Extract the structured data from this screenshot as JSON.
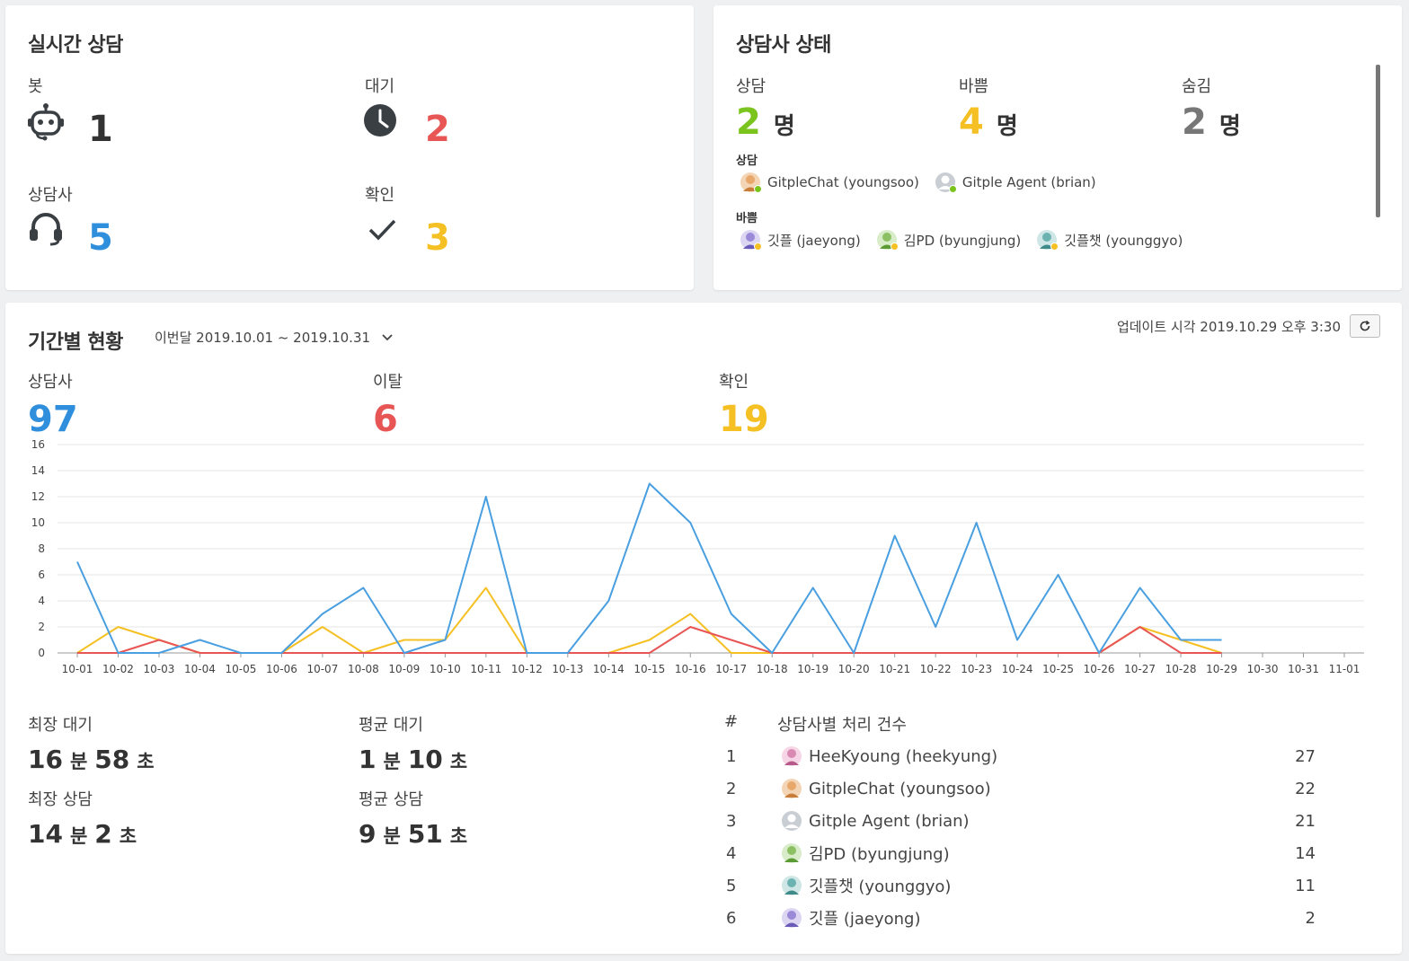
{
  "realtime": {
    "title": "실시간 상담",
    "bot": {
      "label": "봇",
      "value": "1",
      "color": "#333333"
    },
    "waiting": {
      "label": "대기",
      "value": "2",
      "color": "#e85555"
    },
    "agent": {
      "label": "상담사",
      "value": "5",
      "color": "#2f8fdc"
    },
    "confirm": {
      "label": "확인",
      "value": "3",
      "color": "#f5c023"
    }
  },
  "agent_status": {
    "title": "상담사 상태",
    "counsel": {
      "label": "상담",
      "value": "2",
      "unit": "명",
      "color": "#7ac41d"
    },
    "busy": {
      "label": "바쁨",
      "value": "4",
      "unit": "명",
      "color": "#f5c023"
    },
    "hidden": {
      "label": "숨김",
      "value": "2",
      "unit": "명",
      "color": "#777777"
    },
    "groups": [
      {
        "title": "상담",
        "agents": [
          {
            "name": "GitpleChat (youngsoo)",
            "avatar": "avatar-orange-icon",
            "status": "#7ac41d"
          },
          {
            "name": "Gitple Agent (brian)",
            "avatar": "avatar-default-icon",
            "status": "#7ac41d"
          }
        ]
      },
      {
        "title": "바쁨",
        "agents": [
          {
            "name": "깃플 (jaeyong)",
            "avatar": "avatar-purple-icon",
            "status": "#f5c023"
          },
          {
            "name": "김PD (byungjung)",
            "avatar": "avatar-green-icon",
            "status": "#f5c023"
          },
          {
            "name": "깃플챗 (younggyo)",
            "avatar": "avatar-teal-icon",
            "status": "#f5c023"
          }
        ]
      }
    ]
  },
  "period": {
    "title": "기간별 현황",
    "range_label": "이번달 2019.10.01 ~ 2019.10.31",
    "update_label": "업데이트 시각 2019.10.29 오후 3:30",
    "kpis": {
      "agent": {
        "label": "상담사",
        "value": "97",
        "color": "#2f8fdc"
      },
      "leave": {
        "label": "이탈",
        "value": "6",
        "color": "#e85555"
      },
      "confirm": {
        "label": "확인",
        "value": "19",
        "color": "#f5c023"
      }
    },
    "times": {
      "longest_wait": {
        "label": "최장 대기",
        "min": "16",
        "sec": "58",
        "min_unit": "분",
        "sec_unit": "초"
      },
      "avg_wait": {
        "label": "평균 대기",
        "min": "1",
        "sec": "10",
        "min_unit": "분",
        "sec_unit": "초"
      },
      "longest_counsel": {
        "label": "최장 상담",
        "min": "14",
        "sec": "2",
        "min_unit": "분",
        "sec_unit": "초"
      },
      "avg_counsel": {
        "label": "평균 상담",
        "min": "9",
        "sec": "51",
        "min_unit": "분",
        "sec_unit": "초"
      }
    },
    "ranking": {
      "index_header": "#",
      "title": "상담사별 처리 건수",
      "rows": [
        {
          "rank": "1",
          "name": "HeeKyoung (heekyung)",
          "avatar": "avatar-pink-icon",
          "count": "27"
        },
        {
          "rank": "2",
          "name": "GitpleChat (youngsoo)",
          "avatar": "avatar-orange-icon",
          "count": "22"
        },
        {
          "rank": "3",
          "name": "Gitple Agent (brian)",
          "avatar": "avatar-default-icon",
          "count": "21"
        },
        {
          "rank": "4",
          "name": "김PD (byungjung)",
          "avatar": "avatar-green-icon",
          "count": "14"
        },
        {
          "rank": "5",
          "name": "깃플챗 (younggyo)",
          "avatar": "avatar-teal-icon",
          "count": "11"
        },
        {
          "rank": "6",
          "name": "깃플 (jaeyong)",
          "avatar": "avatar-purple-icon",
          "count": "2"
        }
      ]
    }
  },
  "chart_data": {
    "type": "line",
    "categories": [
      "10-01",
      "10-02",
      "10-03",
      "10-04",
      "10-05",
      "10-06",
      "10-07",
      "10-08",
      "10-09",
      "10-10",
      "10-11",
      "10-12",
      "10-13",
      "10-14",
      "10-15",
      "10-16",
      "10-17",
      "10-18",
      "10-19",
      "10-20",
      "10-21",
      "10-22",
      "10-23",
      "10-24",
      "10-25",
      "10-26",
      "10-27",
      "10-28",
      "10-29",
      "10-30",
      "10-31",
      "11-01"
    ],
    "ylim": [
      0,
      16
    ],
    "yticks": [
      "0",
      "2",
      "4",
      "6",
      "8",
      "10",
      "12",
      "14",
      "16"
    ],
    "grid": true,
    "series": [
      {
        "color": "#f5c023",
        "values": [
          0,
          2,
          1,
          0,
          0,
          0,
          2,
          0,
          1,
          1,
          5,
          0,
          0,
          0,
          1,
          3,
          0,
          0,
          0,
          0,
          0,
          0,
          0,
          0,
          0,
          0,
          2,
          1,
          0,
          null,
          null,
          null
        ]
      },
      {
        "color": "#e85555",
        "values": [
          0,
          0,
          1,
          0,
          0,
          0,
          0,
          0,
          0,
          0,
          0,
          0,
          0,
          0,
          0,
          2,
          1,
          0,
          0,
          0,
          0,
          0,
          0,
          0,
          0,
          0,
          2,
          0,
          0,
          null,
          null,
          null
        ]
      },
      {
        "color": "#4a9fe0",
        "values": [
          7,
          0,
          0,
          1,
          0,
          0,
          3,
          5,
          0,
          1,
          12,
          0,
          0,
          4,
          13,
          10,
          3,
          0,
          5,
          0,
          9,
          2,
          10,
          1,
          6,
          0,
          5,
          1,
          1,
          null,
          null,
          null
        ]
      }
    ]
  }
}
